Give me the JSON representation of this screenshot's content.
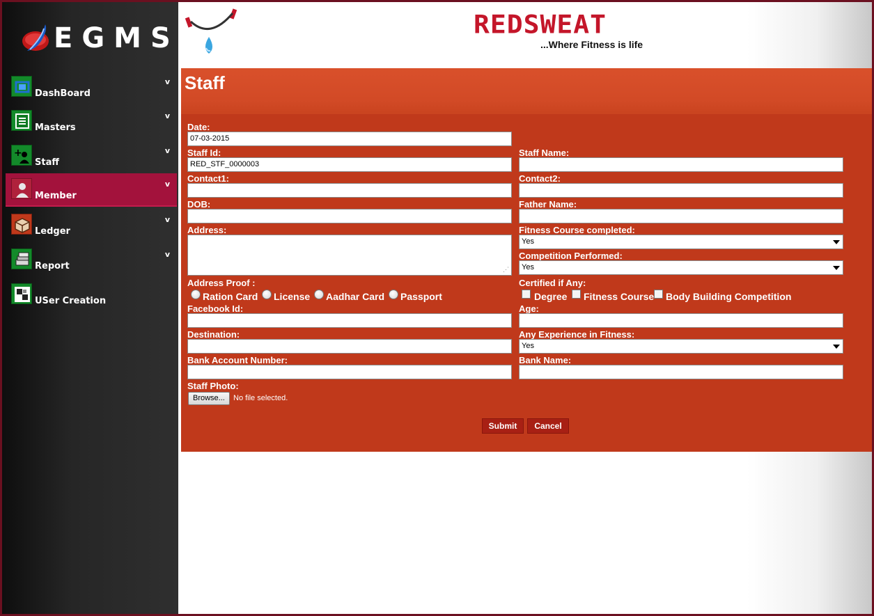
{
  "app": {
    "logo_text": "EGMS"
  },
  "sidebar": {
    "items": [
      {
        "label": "DashBoard",
        "chevron": "v",
        "icon": "dashboard-icon"
      },
      {
        "label": "Masters",
        "chevron": "v",
        "icon": "list-icon"
      },
      {
        "label": "Staff",
        "chevron": "v",
        "icon": "add-user-icon"
      },
      {
        "label": "Member",
        "chevron": "v",
        "icon": "member-icon",
        "active": true
      },
      {
        "label": "Ledger",
        "chevron": "v",
        "icon": "ledger-icon"
      },
      {
        "label": "Report",
        "chevron": "v",
        "icon": "report-icon"
      },
      {
        "label": "USer Creation",
        "icon": "user-creation-icon"
      }
    ]
  },
  "header": {
    "brand": "REDSWEAT",
    "tagline": "...Where Fitness is life"
  },
  "form": {
    "title": "Staff",
    "date_label": "Date:",
    "date_value": "07-03-2015",
    "staff_id_label": "Staff Id:",
    "staff_id_value": "RED_STF_0000003",
    "staff_name_label": "Staff Name:",
    "contact1_label": "Contact1:",
    "contact2_label": "Contact2:",
    "dob_label": "DOB:",
    "father_name_label": "Father Name:",
    "address_label": "Address:",
    "fitness_course_label": "Fitness Course completed:",
    "fitness_course_value": "Yes",
    "competition_label": "Competition Performed:",
    "competition_value": "Yes",
    "address_proof_label": "Address Proof :",
    "address_proof_options": [
      "Ration Card",
      "License",
      "Aadhar Card",
      "Passport"
    ],
    "certified_label": "Certified if Any:",
    "certified_options": [
      "Degree",
      "Fitness Course",
      "Body Building Competition"
    ],
    "facebook_label": "Facebook Id:",
    "age_label": "Age:",
    "destination_label": "Destination:",
    "experience_label": "Any Experience in Fitness:",
    "experience_value": "Yes",
    "bank_account_label": "Bank Account Number:",
    "bank_name_label": "Bank Name:",
    "photo_label": "Staff Photo:",
    "browse_label": "Browse...",
    "no_file_text": "No file selected.",
    "submit_label": "Submit",
    "cancel_label": "Cancel"
  },
  "colors": {
    "panel": "#c0391b",
    "active_nav": "#a3123c",
    "brand": "#c4162a"
  }
}
